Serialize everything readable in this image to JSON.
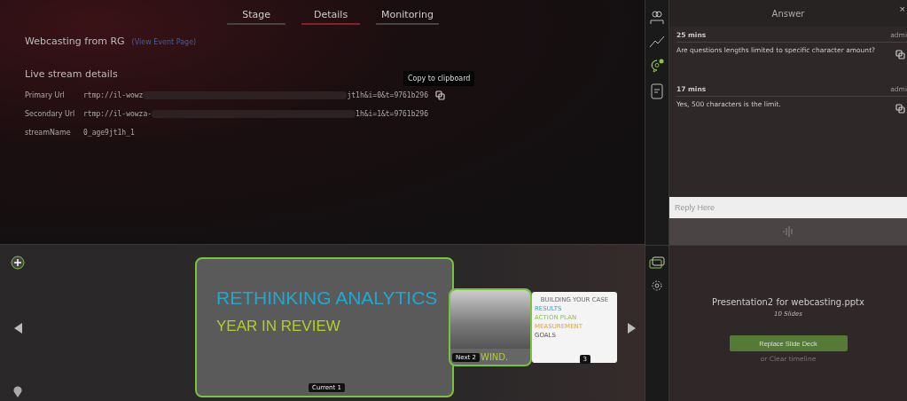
{
  "tabs": [
    {
      "label": "Stage",
      "selected": false
    },
    {
      "label": "Details",
      "selected": true
    },
    {
      "label": "Monitoring",
      "selected": false
    }
  ],
  "event": {
    "title": "Webcasting from RG",
    "link": "(View Event Page)"
  },
  "stream": {
    "heading": "Live stream details",
    "tooltip": "Copy to clipboard",
    "fields": [
      {
        "label": "Primary Url",
        "value_start": "rtmp://il-wowz",
        "value_end": "jt1h&i=0&t=9761b296",
        "redacted": true,
        "copy": true
      },
      {
        "label": "Secondary Url",
        "value_start": "rtmp://il-wowza-",
        "value_end": "1h&i=1&t=9761b296",
        "redacted": true,
        "copy": false
      },
      {
        "label": "streamName",
        "value_start": "0_age9jt1h_1",
        "redacted": false,
        "copy": false
      }
    ]
  },
  "top_rail": [
    {
      "kind": "people",
      "selected": false
    },
    {
      "kind": "chart",
      "selected": false
    },
    {
      "kind": "qa",
      "selected": true
    },
    {
      "kind": "notes",
      "selected": false
    }
  ],
  "answer_panel": {
    "title": "Answer",
    "close": "×",
    "messages": [
      {
        "time": "25 mins",
        "author": "admi",
        "text": "Are questions lengths limited to specific character amount?"
      },
      {
        "time": "17 mins",
        "author": "admi",
        "text": "Yes, 500 characters is the limit."
      }
    ],
    "reply": {
      "placeholder": "Reply Here"
    }
  },
  "slides": [
    {
      "kind": "title",
      "title": "RETHINKING ANALYTICS",
      "subtitle": "YEAR IN REVIEW",
      "badge": "Current 1"
    },
    {
      "kind": "photo",
      "title": "WIND.",
      "badge": "Next 2"
    },
    {
      "kind": "diagram",
      "title": "BUILDING YOUR CASE",
      "items": [
        "RESULTS",
        "ACTION PLAN",
        "MEASUREMENT",
        "GOALS"
      ],
      "badge": "3"
    }
  ],
  "bottom_rail": [
    {
      "kind": "slides",
      "selected": true
    },
    {
      "kind": "settings",
      "selected": false
    }
  ],
  "deck": {
    "name": "Presentation2 for webcasting.pptx",
    "count": "10 Slides",
    "button": "Replace Slide Deck",
    "link": "or Clear timeline"
  }
}
